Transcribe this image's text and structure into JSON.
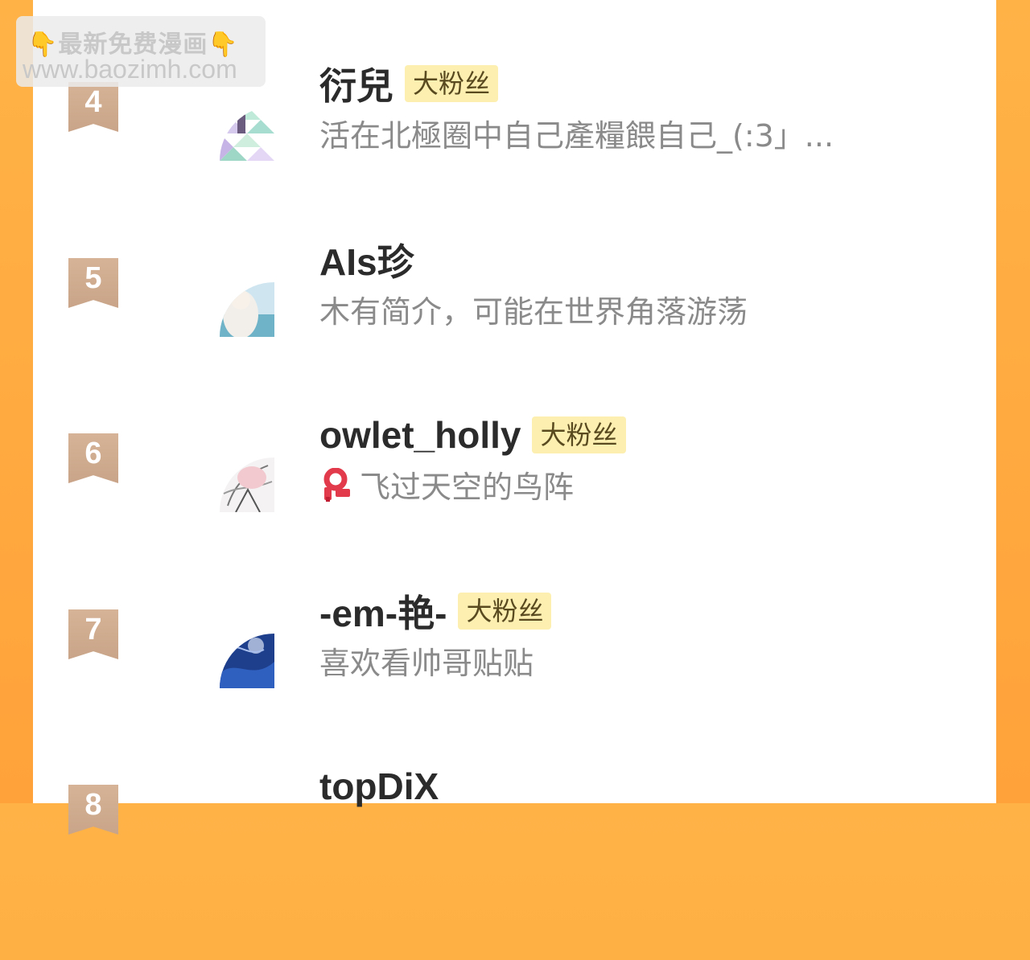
{
  "watermark": {
    "line1": "最新免费漫画",
    "line2": "www.baozimh.com",
    "hand_left": "👇",
    "hand_right": "👇"
  },
  "badge_label": "大粉丝",
  "fans": [
    {
      "rank": "4",
      "name": "衍兒",
      "badge": true,
      "bio": "活在北極圈中自己產糧餵自己_(:3」...",
      "avatar_icon": "triangle-mosaic-avatar"
    },
    {
      "rank": "5",
      "name": "AIs珍",
      "badge": false,
      "bio": "木有简介，可能在世界角落游荡",
      "avatar_icon": "anime-girl-sky-avatar"
    },
    {
      "rank": "6",
      "name": "owlet_holly",
      "badge": true,
      "bio": "飞过天空的鸟阵",
      "bio_icon": "red-scarf-icon",
      "avatar_icon": "sketch-girl-avatar"
    },
    {
      "rank": "7",
      "name": "-em-艳-",
      "badge": true,
      "bio": "喜欢看帅哥贴贴",
      "avatar_icon": "blue-lace-avatar"
    },
    {
      "rank": "8",
      "name": "topDiX",
      "badge": false,
      "bio": "",
      "avatar_icon": "avatar"
    }
  ],
  "colors": {
    "background": "#ffa23a",
    "rank_ribbon": "#cfab8f",
    "badge_bg": "#fcefb0",
    "name_text": "#2b2b2b",
    "bio_text": "#8a8a8a"
  }
}
